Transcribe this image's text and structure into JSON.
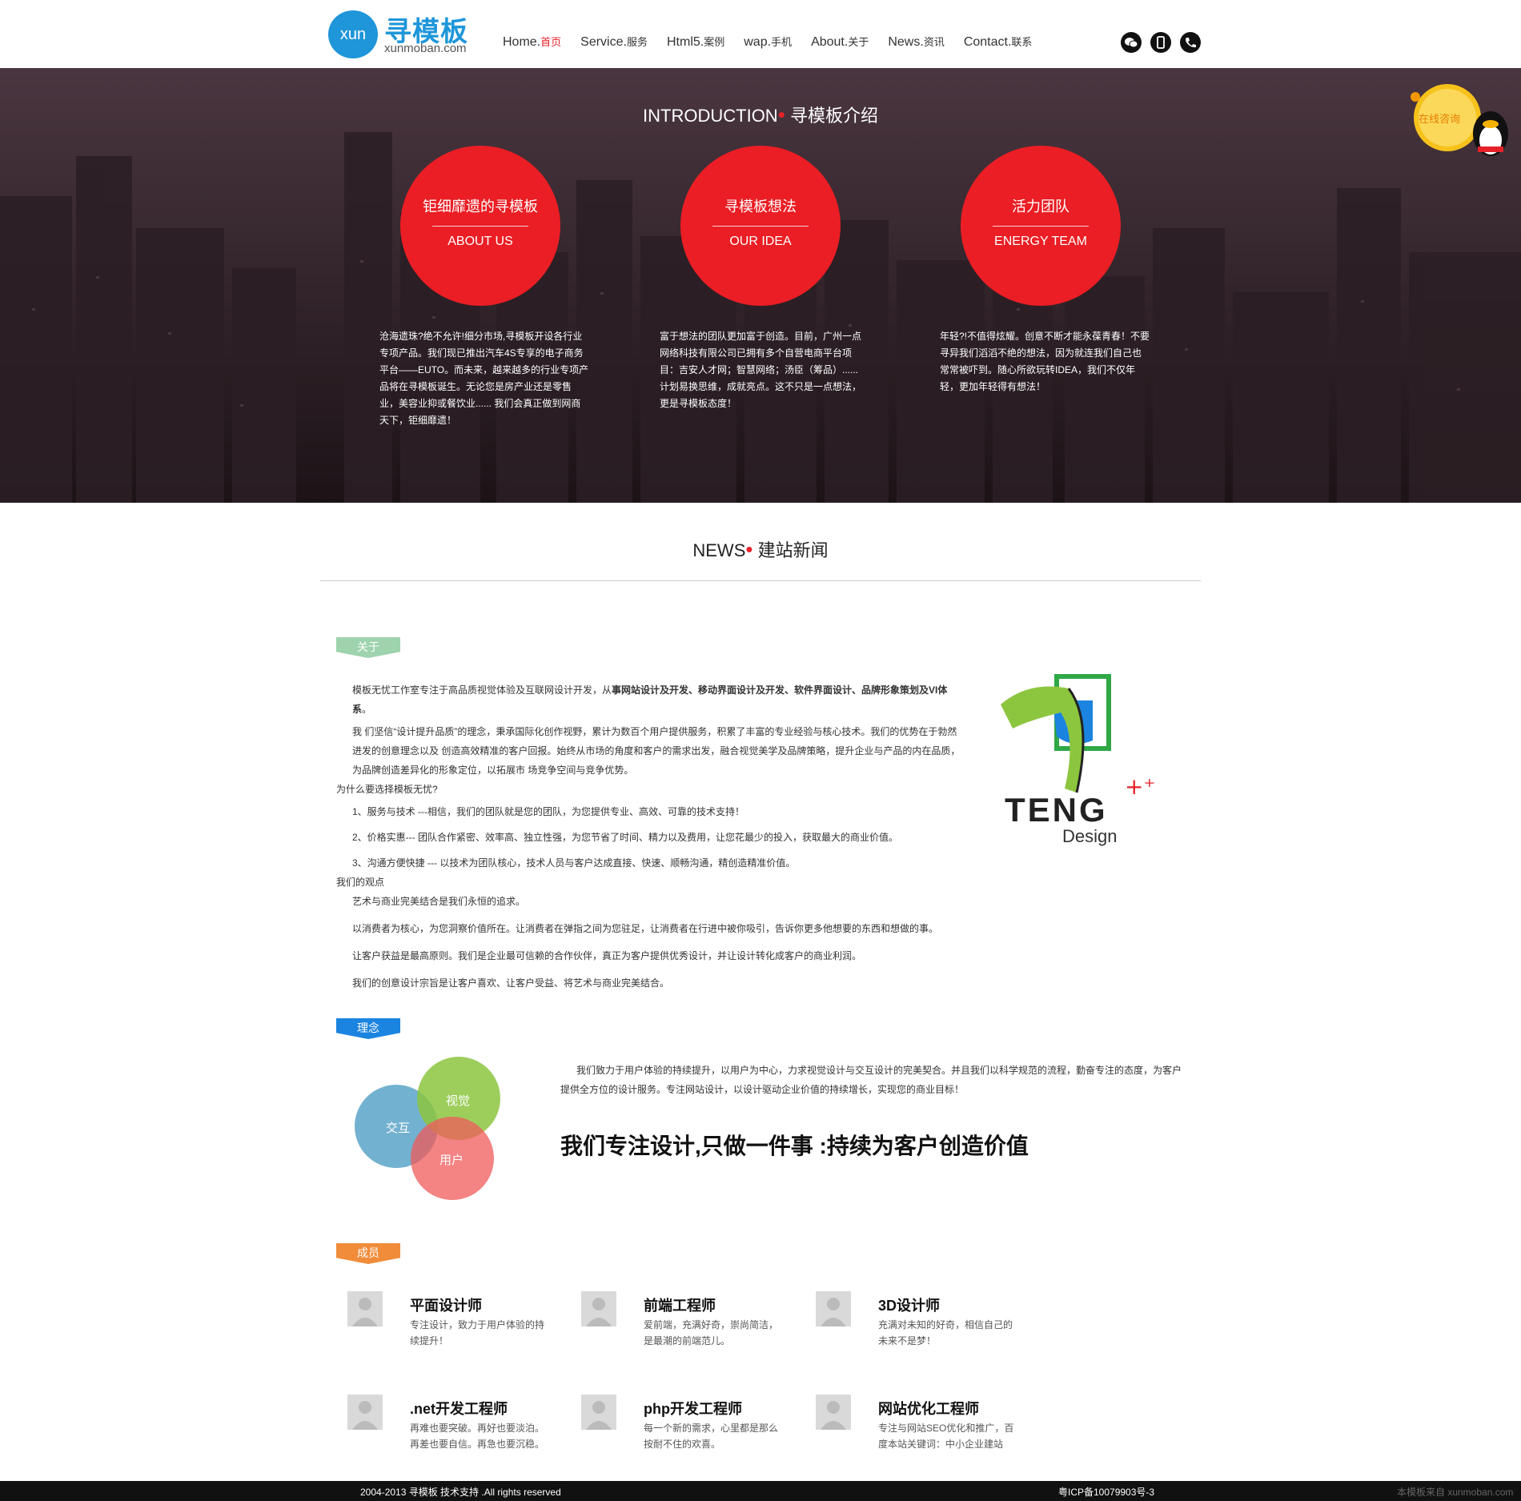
{
  "brand": {
    "logo_bubble": "xun",
    "logo_cn": "寻模板",
    "logo_en": "xunmoban.com",
    "accent": "#e62129",
    "primary_blue": "#1e96d9"
  },
  "nav": {
    "items": [
      {
        "en": "Home",
        "cn": "首页"
      },
      {
        "en": "Service",
        "cn": "服务"
      },
      {
        "en": "Html5",
        "cn": "案例"
      },
      {
        "en": "wap",
        "cn": "手机"
      },
      {
        "en": "About",
        "cn": "关于"
      },
      {
        "en": "News",
        "cn": "资讯"
      },
      {
        "en": "Contact",
        "cn": "联系"
      }
    ],
    "separator": ".",
    "social_icons": [
      "wechat-icon",
      "mobile-icon",
      "phone-icon"
    ]
  },
  "qq": {
    "label": "在线咨询"
  },
  "intro": {
    "title_en": "INTRODUCTION",
    "title_dot": "•",
    "title_cn": "寻模板介绍",
    "circles": [
      {
        "cn": "钜细靡遗的寻模板",
        "en": "ABOUT US"
      },
      {
        "cn": "寻模板想法",
        "en": "OUR IDEA"
      },
      {
        "cn": "活力团队",
        "en": "ENERGY TEAM"
      }
    ],
    "texts": [
      "沧海遗珠?绝不允许!细分市场,寻模板开设各行业专项产品。我们现已推出汽车4S专享的电子商务平台——EUTO。而未来，越来越多的行业专项产品将在寻模板诞生。无论您是房产业还是零售业，美容业抑或餐饮业...... 我们会真正做到网商天下，钜细靡遗！",
      "富于想法的团队更加富于创造。目前，广州一点网络科技有限公司已拥有多个自营电商平台项目：吉安人才网；智慧网络；汤臣（筹品）...... 计划易换思维，成就亮点。这不只是一点想法，更是寻模板态度！",
      "年轻?!不值得炫耀。创意不断才能永葆青春！不要寻异我们滔滔不绝的想法，因为就连我们自己也常常被吓到。随心所欲玩转IDEA，我们不仅年轻，更加年轻得有想法！"
    ]
  },
  "news": {
    "title_en": "NEWS",
    "title_dot": "•",
    "title_cn": "建站新闻"
  },
  "about": {
    "tag": "关于",
    "p1_pre": "模板无忧工作室专注于高品质视觉体验及互联网设计开发，从",
    "p1_bold": "事网站设计及开发、移动界面设计及开发、软件界面设计、品牌形象策划及VI体系",
    "p1_post": "。",
    "p2": "我 们坚信“设计提升品质”的理念，秉承国际化创作视野，累计为数百个用户提供服务，积累了丰富的专业经验与核心技术。我们的优势在于勃然进发的创意理念以及 创造高效精准的客户回报。始终从市场的角度和客户的需求出发，融合视觉美学及品牌策略，提升企业与产品的内在品质，为品牌创造差异化的形象定位，以拓展市 场竞争空间与竞争优势。",
    "why_title": "为什么要选择模板无忧?",
    "why_items": [
      "1、服务与技术 ---相信，我们的团队就是您的团队，为您提供专业、高效、可靠的技术支持！",
      "2、价格实惠--- 团队合作紧密、效率高、独立性强，为您节省了时间、精力以及费用，让您花最少的投入，获取最大的商业价值。",
      "3、沟通方便快捷 --- 以技术为团队核心，技术人员与客户达成直接、快速、顺畅沟通，精创造精准价值。"
    ],
    "view_title": "我们的观点",
    "view_items": [
      "艺术与商业完美结合是我们永恒的追求。",
      "以消费者为核心，为您洞察价值所在。让消费者在弹指之间为您驻足，让消费者在行进中被你吸引，告诉你更多他想要的东西和想做的事。",
      "让客户获益是最高原则。我们是企业最可信赖的合作伙伴，真正为客户提供优秀设计，并让设计转化成客户的商业利润。",
      "我们的创意设计宗旨是让客户喜欢、让客户受益、将艺术与商业完美结合。"
    ],
    "logo_text_main": "TENG",
    "logo_text_sub": "Design"
  },
  "concept": {
    "tag": "理念",
    "venn": {
      "a": "交互",
      "b": "视觉",
      "c": "用户"
    },
    "text": "我们致力于用户体验的持续提升，以用户为中心，力求视觉设计与交互设计的完美契合。并且我们以科学规范的流程，勤奋专注的态度，为客户提供全方位的设计服务。专注网站设计，以设计驱动企业价值的持续增长，实现您的商业目标！",
    "slogan": "我们专注设计,只做一件事 :持续为客户创造价值"
  },
  "members": {
    "tag": "成员",
    "items": [
      {
        "title": "平面设计师",
        "desc": "专注设计，致力于用户体验的持续提升！"
      },
      {
        "title": "前端工程师",
        "desc": "爱前端，充满好奇，崇尚简洁，是最潮的前端范儿。"
      },
      {
        "title": "3D设计师",
        "desc": "充满对未知的好奇，相信自己的未来不是梦！"
      },
      {
        "title": ".net开发工程师",
        "desc": "再难也要突破。再好也要淡泊。再差也要自信。再急也要沉稳。"
      },
      {
        "title": "php开发工程师",
        "desc": "每一个新的需求，心里都是那么按耐不住的欢喜。"
      },
      {
        "title": "网站优化工程师",
        "desc": "专注与网站SEO优化和推广，百度本站关键词：中小企业建站"
      }
    ]
  },
  "footer": {
    "copyright": "2004-2013 寻模板 技术支持 .All rights reserved",
    "icp": "粤ICP备10079903号-3",
    "source": "本模板来自 xunmoban.com"
  }
}
